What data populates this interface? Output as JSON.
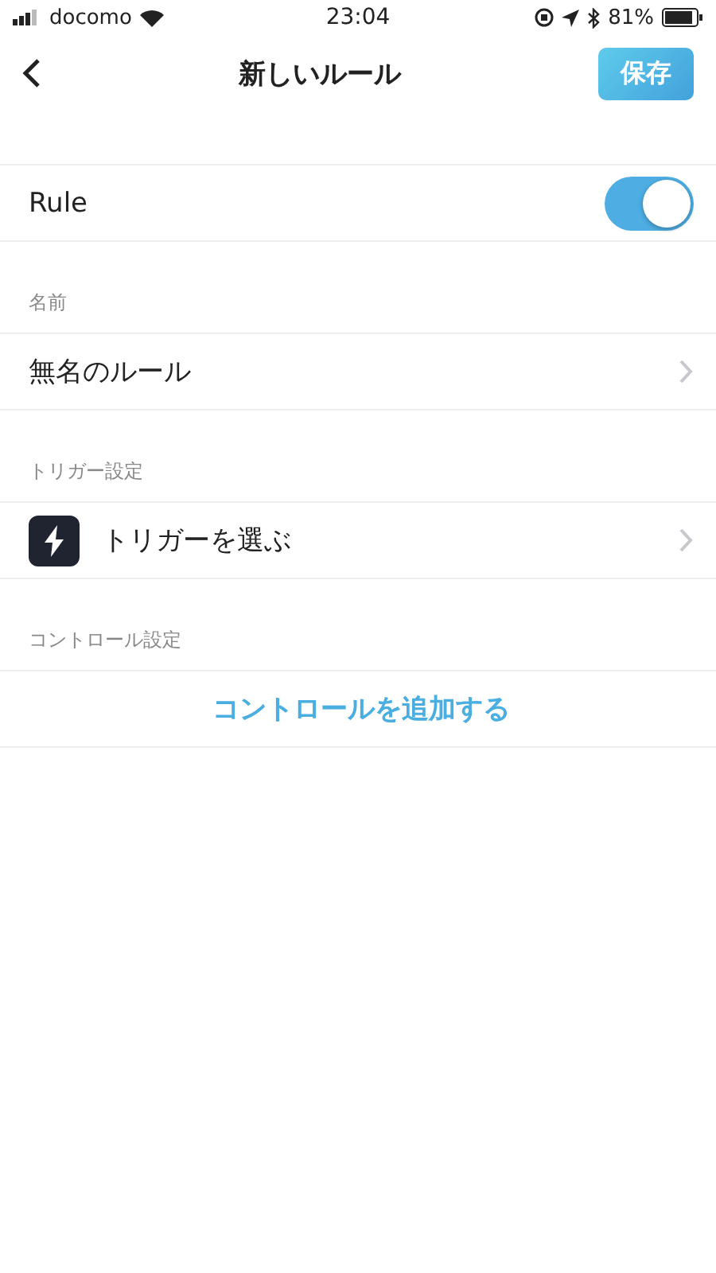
{
  "status_bar": {
    "carrier": "docomo",
    "time": "23:04",
    "battery": "81%"
  },
  "nav": {
    "title": "新しいルール",
    "save": "保存"
  },
  "toggle_row": {
    "label": "Rule",
    "on": true
  },
  "sections": [
    {
      "header": "名前",
      "kind": "text",
      "label": "無名のルール"
    },
    {
      "header": "トリガー設定",
      "kind": "icon",
      "label": "トリガーを選ぶ"
    },
    {
      "header": "コントロール設定",
      "kind": "action",
      "label": "コントロールを追加する"
    }
  ]
}
